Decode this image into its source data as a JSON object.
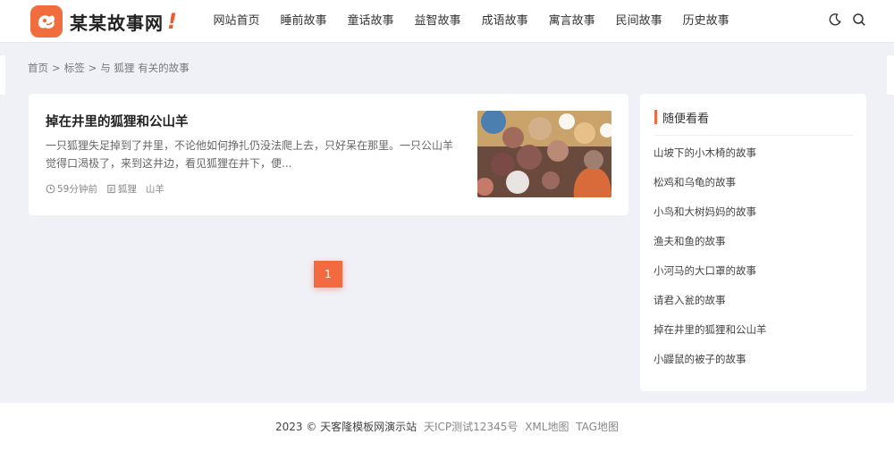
{
  "site": {
    "name": "某某故事网",
    "bang": "!"
  },
  "nav": {
    "items": [
      "网站首页",
      "睡前故事",
      "童话故事",
      "益智故事",
      "成语故事",
      "寓言故事",
      "民间故事",
      "历史故事"
    ]
  },
  "header_icons": [
    "moon-icon",
    "search-icon"
  ],
  "breadcrumb": {
    "home": "首页",
    "sep1": ">",
    "tags": "标签",
    "sep2": ">",
    "current": "与 狐狸 有关的故事"
  },
  "article": {
    "title": "掉在井里的狐狸和公山羊",
    "excerpt": "一只狐狸失足掉到了井里，不论他如何挣扎仍没法爬上去，只好呆在那里。一只公山羊觉得口渴极了，来到这井边，看见狐狸在井下，便...",
    "time": "59分钟前",
    "tags": [
      "狐狸",
      "山羊"
    ]
  },
  "pagination": {
    "current": "1"
  },
  "sidebar": {
    "title": "随便看看",
    "items": [
      "山坡下的小木椅的故事",
      "松鸡和乌龟的故事",
      "小鸟和大树妈妈的故事",
      "渔夫和鱼的故事",
      "小河马的大口罩的故事",
      "请君入瓮的故事",
      "掉在井里的狐狸和公山羊",
      "小鼹鼠的被子的故事"
    ]
  },
  "footer": {
    "copyright": "2023 © 天客隆模板网演示站",
    "icp": "天ICP测试12345号",
    "xml_map": "XML地图",
    "tag_map": "TAG地图"
  },
  "colors": {
    "accent": "#f26a40",
    "background": "#f0f0f7"
  }
}
